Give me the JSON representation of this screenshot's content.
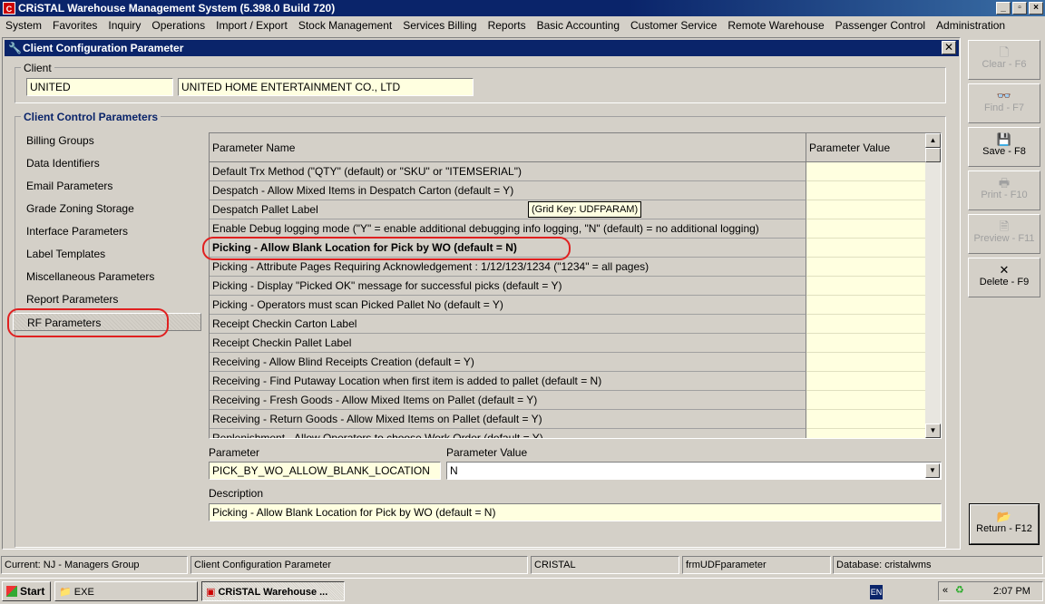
{
  "window": {
    "title": "CRiSTAL Warehouse Management System (5.398.0 Build 720)",
    "app_icon": "cristal-logo-icon",
    "controls": [
      "minimize",
      "maximize",
      "close"
    ]
  },
  "menu": [
    "System",
    "Favorites",
    "Inquiry",
    "Operations",
    "Import / Export",
    "Stock Management",
    "Services Billing",
    "Reports",
    "Basic Accounting",
    "Customer Service",
    "Remote Warehouse",
    "Passenger Control",
    "Administration"
  ],
  "form": {
    "title": "Client Configuration Parameter",
    "client_legend": "Client",
    "client_code": "UNITED",
    "client_name": "UNITED HOME ENTERTAINMENT CO., LTD",
    "params_legend": "Client Control Parameters",
    "categories": [
      "Billing Groups",
      "Data Identifiers",
      "Email Parameters",
      "Grade Zoning Storage",
      "Interface Parameters",
      "Label Templates",
      "Miscellaneous Parameters",
      "Report Parameters",
      "RF Parameters"
    ],
    "selected_category": "RF Parameters",
    "grid": {
      "col_name": "Parameter Name",
      "col_value": "Parameter Value",
      "rows": [
        "Default Trx Method (\"QTY\" (default) or \"SKU\" or \"ITEMSERIAL\")",
        "Despatch - Allow Mixed Items in Despatch Carton (default = Y)",
        "Despatch Pallet Label",
        "Enable Debug logging mode (\"Y\" = enable additional debugging info logging, \"N\" (default) = no additional logging)",
        "Picking - Allow Blank Location for Pick by WO (default = N)",
        "Picking - Attribute Pages Requiring Acknowledgement : 1/12/123/1234 (\"1234\" = all pages)",
        "Picking - Display \"Picked OK\" message for successful picks (default = Y)",
        "Picking - Operators must scan Picked Pallet No (default = Y)",
        "Receipt Checkin Carton Label",
        "Receipt Checkin Pallet Label",
        "Receiving - Allow Blind Receipts Creation (default = Y)",
        "Receiving - Find Putaway Location when first item is added to pallet (default = N)",
        "Receiving - Fresh Goods - Allow Mixed Items on Pallet (default = Y)",
        "Receiving - Return Goods - Allow Mixed Items on Pallet (default = Y)",
        "Replenishment - Allow Operators to choose Work Order (default = Y)"
      ],
      "selected_row_index": 4,
      "tooltip": "(Grid Key: UDFPARAM)"
    },
    "parameter_label": "Parameter",
    "parameter_value": "PICK_BY_WO_ALLOW_BLANK_LOCATION",
    "value_label": "Parameter Value",
    "value_selected": "N",
    "description_label": "Description",
    "description_value": "Picking - Allow Blank Location for Pick by WO (default = N)"
  },
  "toolbar": {
    "clear": "Clear - F6",
    "find": "Find - F7",
    "save": "Save - F8",
    "print": "Print - F10",
    "preview": "Preview - F11",
    "delete": "Delete - F9",
    "return": "Return - F12",
    "icons": {
      "clear": "document-icon",
      "find": "binoculars-icon",
      "save": "floppy-disk-icon",
      "print": "printer-icon",
      "preview": "print-preview-icon",
      "delete": "x-icon",
      "return": "return-folder-icon"
    }
  },
  "status": {
    "current": "Current: NJ - Managers Group",
    "screen": "Client Configuration Parameter",
    "system": "CRISTAL",
    "form": "frmUDFparameter",
    "database": "Database: cristalwms"
  },
  "taskbar": {
    "start": "Start",
    "tasks": [
      "EXE",
      "CRiSTAL Warehouse ..."
    ],
    "lang": "EN",
    "time": "2:07 PM"
  },
  "colors": {
    "titlebar": "#0a246a",
    "field_bg": "#ffffe0",
    "highlight_oval": "#e02020",
    "face": "#d4d0c8"
  }
}
